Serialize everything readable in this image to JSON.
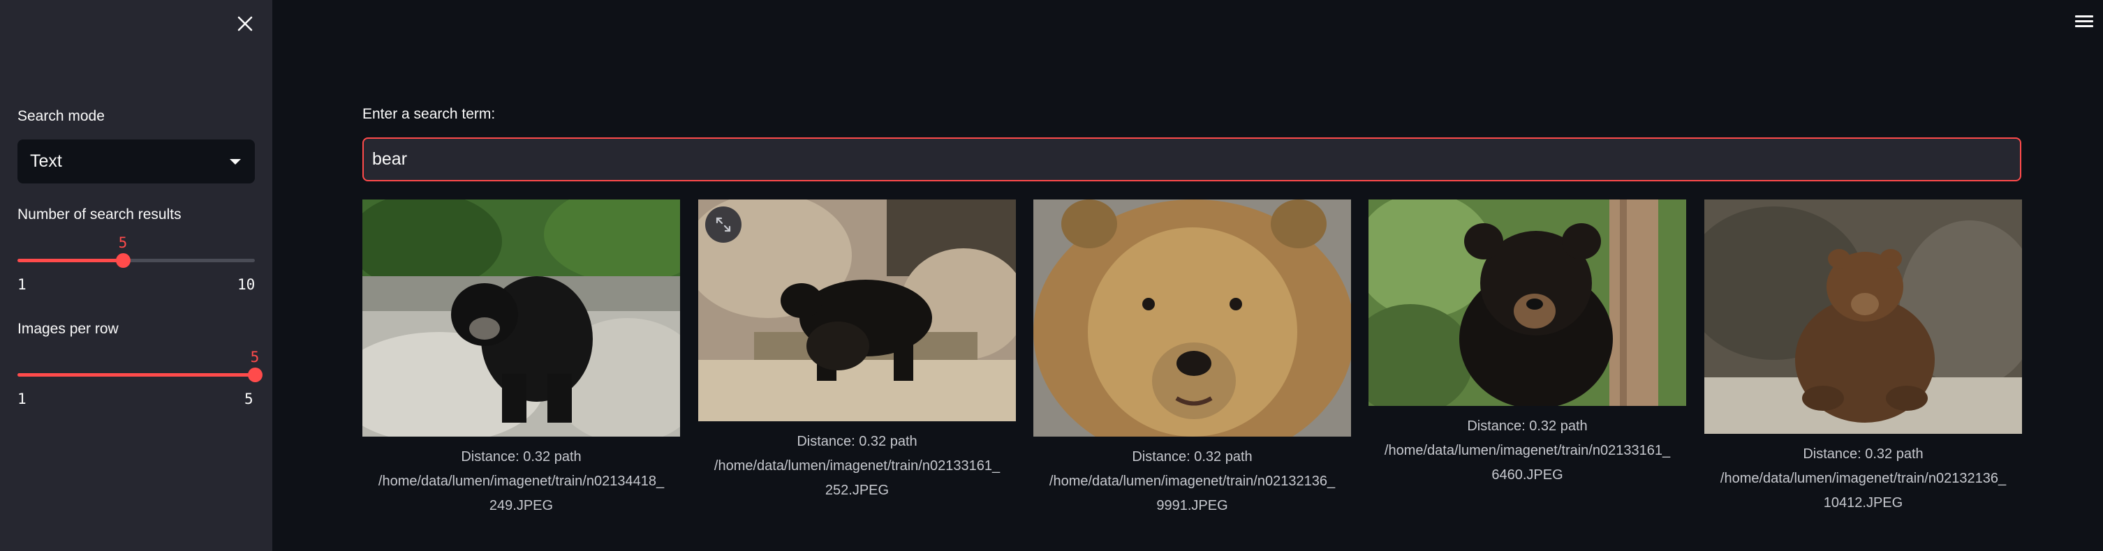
{
  "sidebar": {
    "search_mode_label": "Search mode",
    "search_mode_value": "Text",
    "num_results_label": "Number of search results",
    "num_results": {
      "value": "5",
      "min": "1",
      "max": "10",
      "fraction": 0.4444
    },
    "images_per_row_label": "Images per row",
    "images_per_row": {
      "value": "5",
      "min": "1",
      "max": "5",
      "fraction": 1.0
    }
  },
  "main": {
    "search_label": "Enter a search term:",
    "search_value": "bear"
  },
  "results": [
    {
      "distance_line": "Distance: 0.32 path",
      "path_line1": "/home/data/lumen/imagenet/train/n02134418_",
      "path_line2": "249.JPEG"
    },
    {
      "distance_line": "Distance: 0.32 path",
      "path_line1": "/home/data/lumen/imagenet/train/n02133161_",
      "path_line2": "252.JPEG"
    },
    {
      "distance_line": "Distance: 0.32 path",
      "path_line1": "/home/data/lumen/imagenet/train/n02132136_",
      "path_line2": "9991.JPEG"
    },
    {
      "distance_line": "Distance: 0.32 path",
      "path_line1": "/home/data/lumen/imagenet/train/n02133161_",
      "path_line2": "6460.JPEG"
    },
    {
      "distance_line": "Distance: 0.32 path",
      "path_line1": "/home/data/lumen/imagenet/train/n02132136_",
      "path_line2": "10412.JPEG"
    }
  ],
  "colors": {
    "accent": "#ff4b4b",
    "background": "#0e1117",
    "sidebar": "#262730"
  }
}
